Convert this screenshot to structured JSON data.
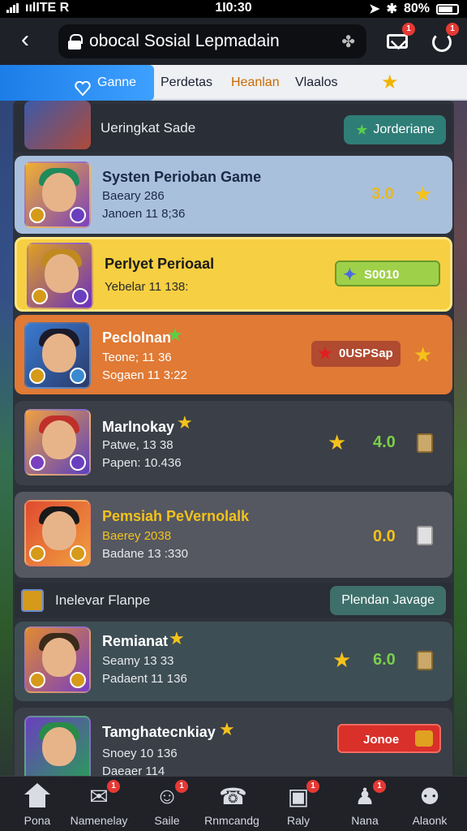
{
  "status": {
    "carrier": "ıılITE R",
    "time": "1I0:30",
    "battery": "80%"
  },
  "topbar": {
    "url": "obocal Sosial Lepmadain"
  },
  "tabs": [
    {
      "label": "Ganne"
    },
    {
      "label": "Perdetas"
    },
    {
      "label": "Heanlan"
    },
    {
      "label": "Vlaalos"
    },
    {
      "label": "★"
    }
  ],
  "sections": [
    {
      "label": "Ueringkat Sade",
      "button": "Jorderiane"
    },
    {
      "label": "Inelevar Flanpe",
      "button": "Plendan Javage"
    }
  ],
  "cards": [
    {
      "title": "Systen Perioban Game",
      "line1": "Baeary 286",
      "line2": "Janoen 11 8;36",
      "score": "3.0",
      "color": "light"
    },
    {
      "title": "Perlyet Perioaal",
      "line1": "Yebelar 11 138:",
      "action": "S0010",
      "color": "yellow"
    },
    {
      "title": "Peclolnan",
      "line1": "Teone; 11 36",
      "line2": "Sogaen 11 3:22",
      "action": "0USPSap",
      "color": "orange"
    },
    {
      "title": "Marlnokay",
      "line1": "Patwe, 13 38",
      "line2": "Papen: 10.436",
      "score": "4.0",
      "color": "dark"
    },
    {
      "title": "Pemsiah PeVernolalk",
      "line1": "Baerey 2038",
      "line2": "Badane 13 :330",
      "score": "0.0",
      "color": "dark2"
    },
    {
      "title": "Remianat",
      "line1": "Seamy 13 33",
      "line2": "Padaent 11 136",
      "score": "6.0",
      "color": "teal"
    },
    {
      "title": "Tamghatecnkiay",
      "line1": "Snoey 10 136",
      "line2": "Daeaer 114",
      "action": "Jonoe",
      "color": "dark"
    }
  ],
  "nav": [
    {
      "label": "Pona"
    },
    {
      "label": "Namenelay"
    },
    {
      "label": "Saile"
    },
    {
      "label": "Rnmcandg"
    },
    {
      "label": "Raly"
    },
    {
      "label": "Nana"
    },
    {
      "label": "Alaonk"
    }
  ],
  "badges": {
    "mail": "1",
    "refresh": "1",
    "nav_dot": "1"
  },
  "colors": {
    "accent": "#1c7de8",
    "yellow_card": "#f6cf42",
    "orange_card": "#e07a35",
    "star": "#f4c21b",
    "red_badge": "#e53935"
  }
}
